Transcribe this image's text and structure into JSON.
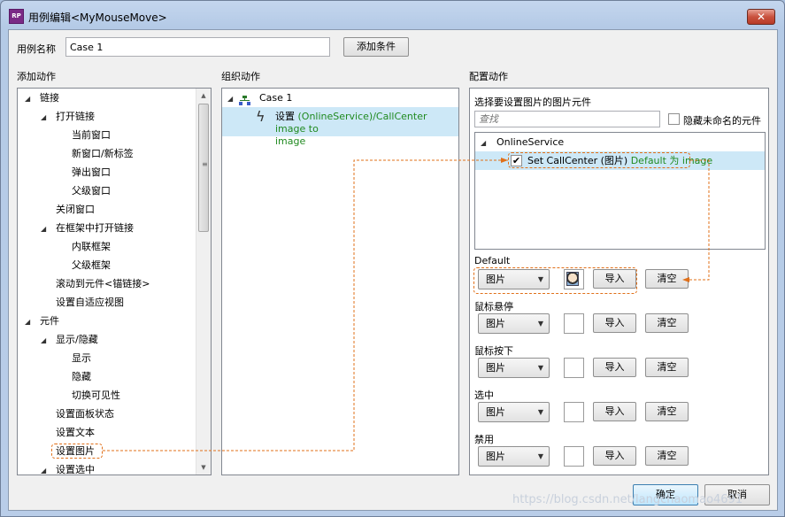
{
  "window": {
    "title": "用例编辑<MyMouseMove>",
    "app_icon_text": "RP",
    "close_symbol": "✕"
  },
  "case_name": {
    "label": "用例名称",
    "value": "Case 1",
    "add_condition_label": "添加条件"
  },
  "add_actions": {
    "header": "添加动作",
    "items": [
      {
        "label": "链接",
        "level": 0,
        "expanded": true
      },
      {
        "label": "打开链接",
        "level": 1,
        "expanded": true
      },
      {
        "label": "当前窗口",
        "level": 2
      },
      {
        "label": "新窗口/新标签",
        "level": 2
      },
      {
        "label": "弹出窗口",
        "level": 2
      },
      {
        "label": "父级窗口",
        "level": 2
      },
      {
        "label": "关闭窗口",
        "level": 1
      },
      {
        "label": "在框架中打开链接",
        "level": 1,
        "expanded": true
      },
      {
        "label": "内联框架",
        "level": 2
      },
      {
        "label": "父级框架",
        "level": 2
      },
      {
        "label": "滚动到元件<锚链接>",
        "level": 1
      },
      {
        "label": "设置自适应视图",
        "level": 1
      },
      {
        "label": "元件",
        "level": 0,
        "expanded": true
      },
      {
        "label": "显示/隐藏",
        "level": 1,
        "expanded": true
      },
      {
        "label": "显示",
        "level": 2
      },
      {
        "label": "隐藏",
        "level": 2
      },
      {
        "label": "切换可见性",
        "level": 2
      },
      {
        "label": "设置面板状态",
        "level": 1
      },
      {
        "label": "设置文本",
        "level": 1
      },
      {
        "label": "设置图片",
        "level": 1,
        "highlighted": true
      },
      {
        "label": "设置选中",
        "level": 1,
        "expanded": true
      }
    ]
  },
  "organize_actions": {
    "header": "组织动作",
    "case_label": "Case 1",
    "action_prefix": "设置 ",
    "action_detail_line1": "(OnlineService)/CallCenter image to",
    "action_detail_line2": "image"
  },
  "config_actions": {
    "header": "配置动作",
    "select_label": "选择要设置图片的图片元件",
    "search_placeholder": "查找",
    "hide_unnamed_label": "隐藏未命名的元件",
    "tree_group": "OnlineService",
    "tree_item_main": "Set CallCenter (图片) ",
    "tree_item_detail": "Default 为 image",
    "states": [
      {
        "label": "Default",
        "select": "图片",
        "import": "导入",
        "clear": "清空",
        "has_image": true
      },
      {
        "label": "鼠标悬停",
        "select": "图片",
        "import": "导入",
        "clear": "清空",
        "has_image": false
      },
      {
        "label": "鼠标按下",
        "select": "图片",
        "import": "导入",
        "clear": "清空",
        "has_image": false
      },
      {
        "label": "选中",
        "select": "图片",
        "import": "导入",
        "clear": "清空",
        "has_image": false
      },
      {
        "label": "禁用",
        "select": "图片",
        "import": "导入",
        "clear": "清空",
        "has_image": false
      }
    ]
  },
  "footer": {
    "ok_label": "确定",
    "cancel_label": "取消"
  },
  "watermark": "https://blog.csdn.net/langchaomao4691",
  "icons": {
    "expand": "◢",
    "scroll_up": "▲",
    "scroll_down": "▼",
    "dropdown": "▼",
    "check": "✔",
    "lightning": "ϟ"
  },
  "colors": {
    "selection": "#cde8f7",
    "highlight_dash": "#e0701a",
    "green_text": "#208a20",
    "primary_button_border": "#3c7fb1"
  }
}
